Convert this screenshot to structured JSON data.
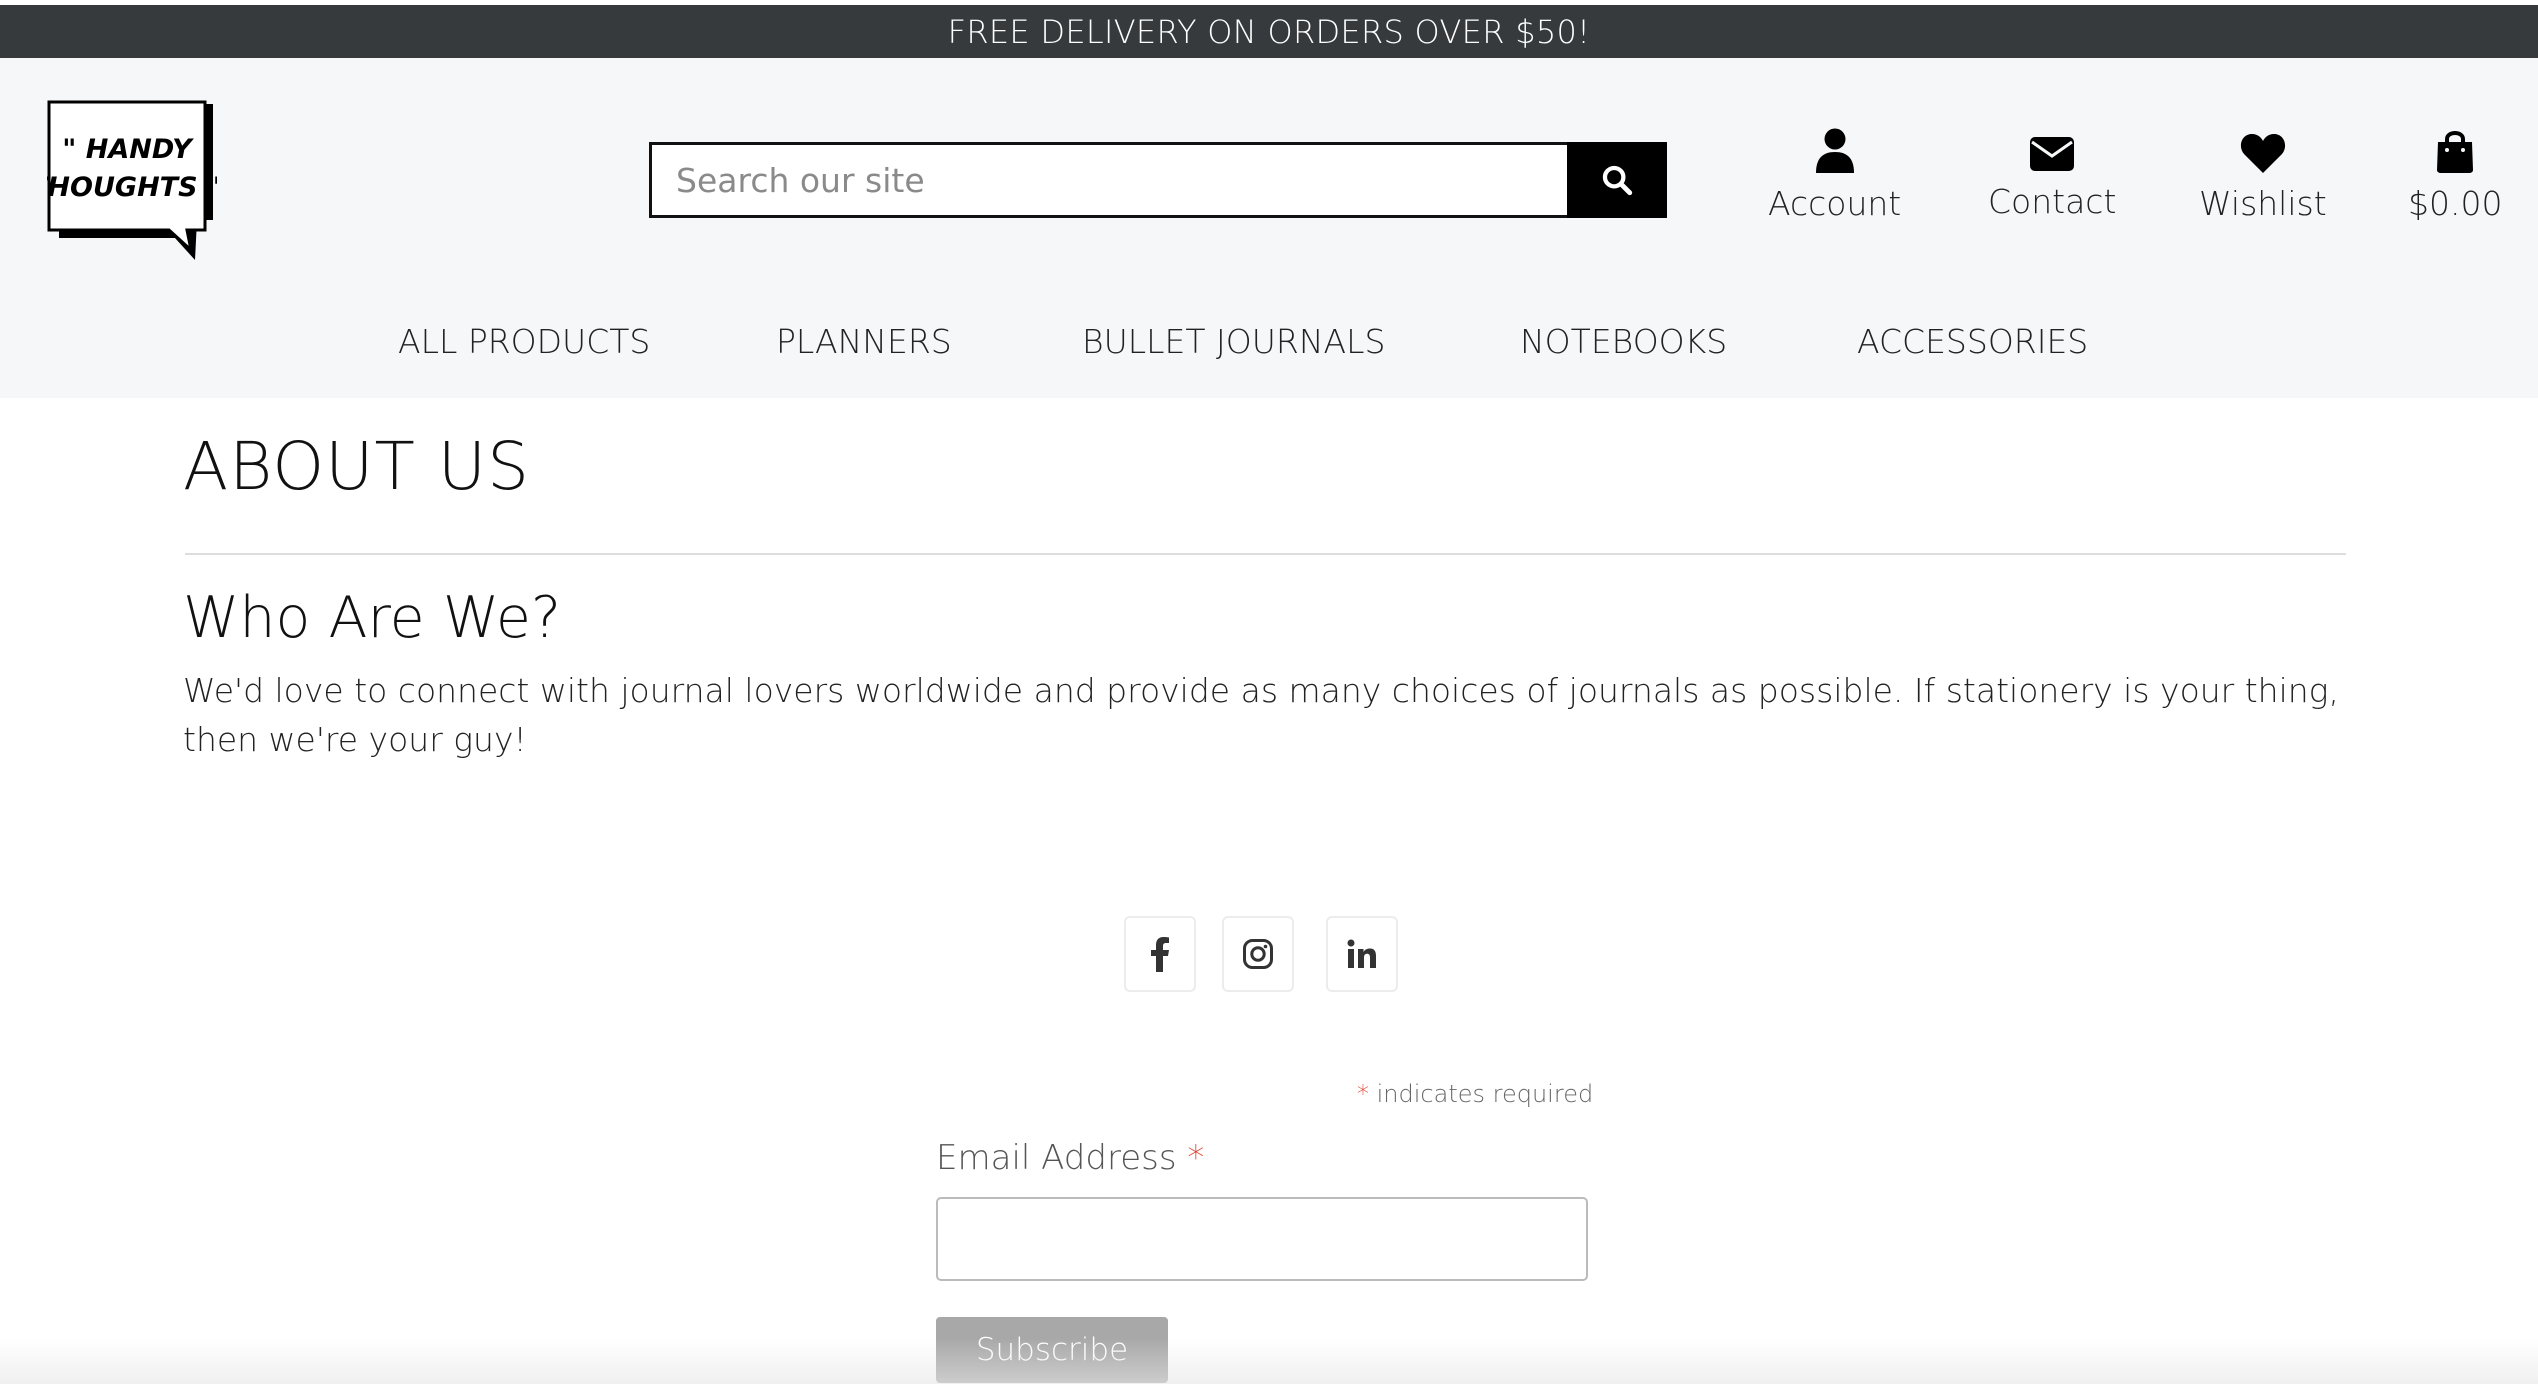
{
  "announcement": "FREE DELIVERY ON ORDERS OVER $50!",
  "logo": {
    "line1": "\" HANDY",
    "line2": "THOUGHTS \""
  },
  "search": {
    "placeholder": "Search our site"
  },
  "header_links": {
    "account": "Account",
    "contact": "Contact",
    "wishlist": "Wishlist",
    "cart_total": "$0.00"
  },
  "nav": [
    "ALL PRODUCTS",
    "PLANNERS",
    "BULLET JOURNALS",
    "NOTEBOOKS",
    "ACCESSORIES"
  ],
  "page": {
    "title": "ABOUT US",
    "section_heading": "Who Are We?",
    "section_text": "We'd love to connect with journal lovers worldwide and provide as many choices of journals as possible. If stationery is your thing, then we're your guy!"
  },
  "social": [
    "facebook-icon",
    "instagram-icon",
    "linkedin-icon"
  ],
  "newsletter": {
    "required_star": "*",
    "required_note": "indicates required",
    "email_label": "Email Address",
    "email_value": "",
    "subscribe_label": "Subscribe"
  },
  "colors": {
    "announcement_bg": "#373a3d",
    "header_bg": "#f6f7f8",
    "required_star": "#e23a2a",
    "subscribe_bg": "#a8a8a8"
  }
}
